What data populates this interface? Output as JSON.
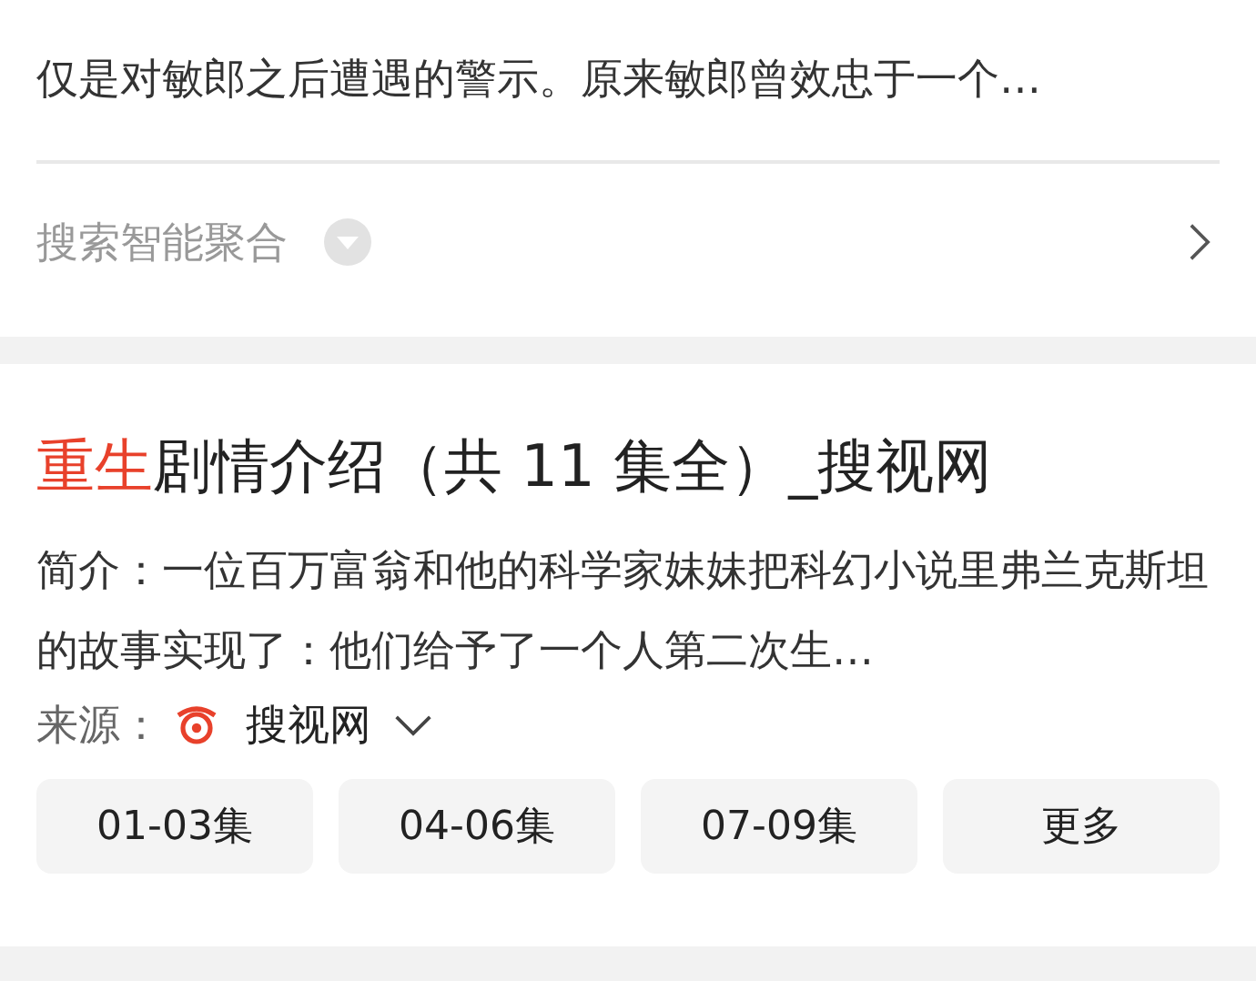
{
  "result_1": {
    "snippet_tail": "仅是对敏郎之后遭遇的警示。原来敏郎曾效忠于一个…",
    "aggregate": {
      "label": "搜索智能聚合"
    }
  },
  "result_2": {
    "title": {
      "highlight": "重生",
      "rest": "剧情介绍（共 11 集全）_搜视网"
    },
    "snippet": "简介：一位百万富翁和他的科学家妹妹把科幻小说里弗兰克斯坦的故事实现了：他们给予了一个人第二次生…",
    "source": {
      "label": "来源：",
      "name": "搜视网"
    },
    "episodes": [
      {
        "label": "01-03集"
      },
      {
        "label": "04-06集"
      },
      {
        "label": "07-09集"
      },
      {
        "label": "更多"
      }
    ]
  }
}
